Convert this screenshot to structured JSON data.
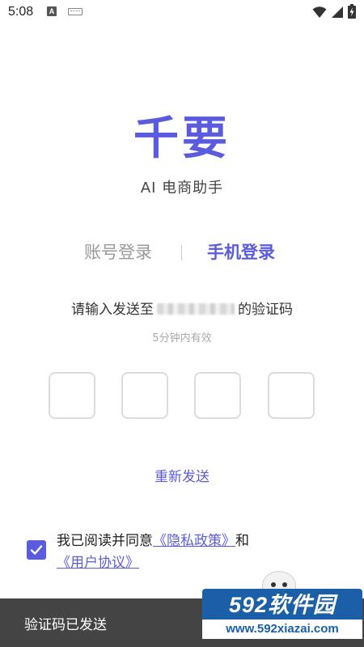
{
  "status_bar": {
    "time": "5:08",
    "notification_icon_label": "A",
    "icons": [
      "a-notification-icon",
      "keyboard-icon",
      "wifi-icon",
      "signal-icon",
      "battery-charging-icon"
    ]
  },
  "brand": {
    "title": "千要",
    "subtitle": "AI 电商助手"
  },
  "tabs": [
    {
      "label": "账号登录",
      "active": false
    },
    {
      "label": "手机登录",
      "active": true
    }
  ],
  "verification": {
    "prompt_prefix": "请输入发送至",
    "prompt_suffix": "的验证码",
    "validity": "5分钟内有效",
    "code_length": 4,
    "resend_label": "重新发送"
  },
  "agreement": {
    "checked": true,
    "prefix": "我已阅读并同意",
    "privacy_link": "《隐私政策》",
    "conjunction": "和",
    "terms_link": "《用户协议》"
  },
  "toast": {
    "message": "验证码已发送"
  },
  "watermark": {
    "logo_text": "592软件园",
    "url_text": "www.592xiazai.com"
  },
  "colors": {
    "accent": "#5b5be0",
    "toast_bg": "#444444",
    "watermark_blue": "#1a5fa8"
  }
}
